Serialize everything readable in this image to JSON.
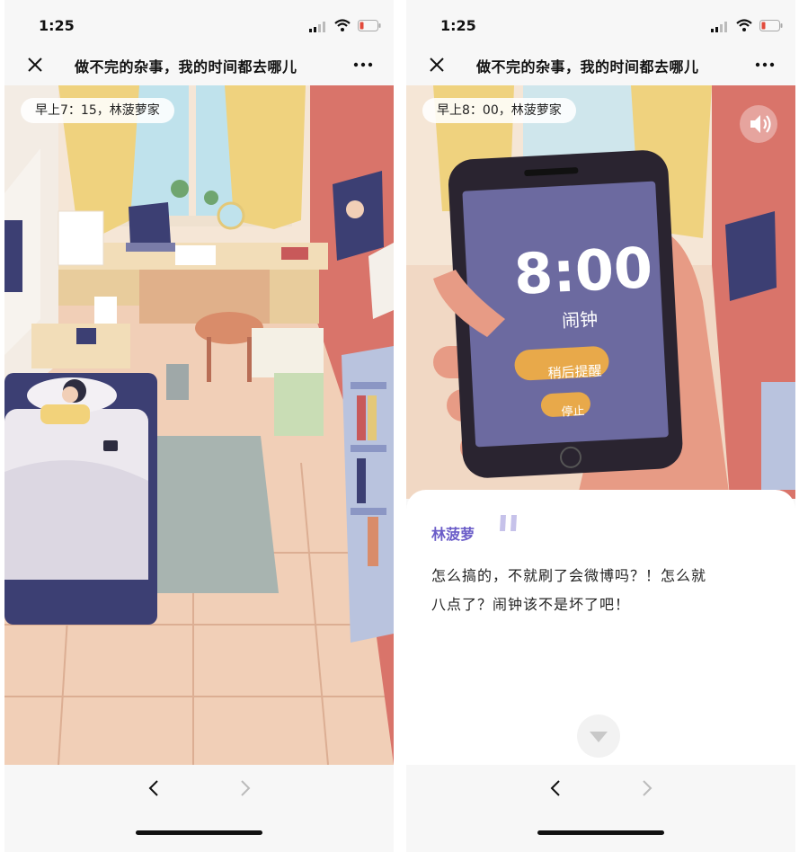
{
  "left": {
    "status": {
      "time": "1:25"
    },
    "nav": {
      "title": "做不完的杂事，我的时间都去哪儿"
    },
    "scene": {
      "badge": "早上7：15，林菠萝家"
    }
  },
  "right": {
    "status": {
      "time": "1:25"
    },
    "nav": {
      "title": "做不完的杂事，我的时间都去哪儿"
    },
    "scene": {
      "badge": "早上8：00，林菠萝家",
      "phone_clock": "8:00",
      "phone_label": "闹钟",
      "snooze_label": "稍后提醒",
      "stop_label": "停止"
    },
    "dialogue": {
      "speaker": "林菠萝",
      "line1": "怎么搞的，不就刷了会微博吗？！怎么就",
      "line2": "八点了？闹钟该不是坏了吧！"
    }
  },
  "icons": [
    "signal-icon",
    "wifi-icon",
    "battery-icon",
    "close-icon",
    "more-icon",
    "sound-icon",
    "quote-icon",
    "chevron-down-icon",
    "back-arrow-icon",
    "forward-arrow-icon"
  ],
  "colors": {
    "accent": "#6a5cc8",
    "battery_low": "#e24a3b",
    "wall": "#d9746a",
    "curtain": "#efd27e",
    "floor": "#f1cfb7",
    "bed": "#3c3f73",
    "phone_screen": "#6c6aa0"
  }
}
